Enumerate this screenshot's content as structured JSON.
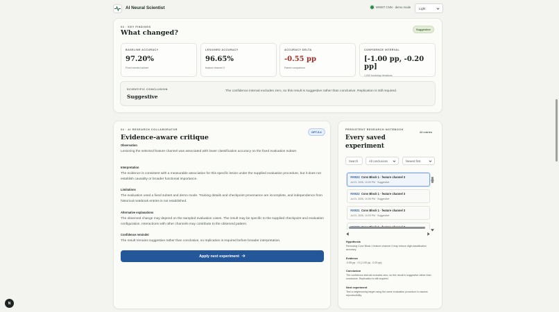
{
  "header": {
    "brand_name": "AI Neural Scientist",
    "status_text": "MNIST CNN · demo mode",
    "theme_value": "Light",
    "status_color": "#2f8a4b"
  },
  "findings": {
    "eyebrow": "03 · KEY FINDINGS",
    "title": "What changed?",
    "badge": "Suggestive",
    "metrics": [
      {
        "label": "BASELINE ACCURACY",
        "value": "97.20%",
        "sub": "Fixed seeded subset"
      },
      {
        "label": "LESIONED ACCURACY",
        "value": "96.65%",
        "sub": "feature channel 3"
      },
      {
        "label": "ACCURACY DELTA",
        "value": "-0.55 pp",
        "sub": "Paired comparison"
      },
      {
        "label": "CONFIDENCE INTERVAL",
        "value": "[-1.00 pp, -0.20 pp]",
        "sub": "1,000 bootstrap iterations"
      }
    ],
    "conclusion_label": "SCIENTIFIC CONCLUSION",
    "conclusion_word": "Suggestive",
    "conclusion_text": "The confidence interval excludes zero, so this result is suggestive rather than conclusive. Replication is still required."
  },
  "critique": {
    "eyebrow": "04 · AI RESEARCH COLLABORATOR",
    "title": "Evidence-aware critique",
    "badge": "GPT-5.4",
    "sections": [
      {
        "title": "Observation",
        "body": "Lesioning the selected feature channel was associated with lower classification accuracy on the fixed evaluation subset."
      },
      {
        "title": "Interpretation",
        "body": "The evidence is consistent with a measurable association for this specific lesion under the supplied evaluation procedure, but it does not establish causality or broader functional importance."
      },
      {
        "title": "Limitations",
        "body": "The evaluation used a fixed subset and demo mode. Training details and checkpoint provenance are incomplete, and independence from historical notebook entries is not established."
      },
      {
        "title": "Alternative explanations",
        "body": "The observed change may depend on the sampled evaluation cases. The result may be specific to the supplied checkpoint and evaluation configuration. Interactions with other channels may contribute to the observed pattern."
      },
      {
        "title": "Confidence reminder",
        "body": "The result remains suggestive rather than conclusive, so replication is required before broader interpretation."
      }
    ],
    "apply_button": "Apply next experiment",
    "accent": "#24569a"
  },
  "notebook": {
    "eyebrow": "PERSISTENT RESEARCH NOTEBOOK",
    "title_line1": "Every saved",
    "title_line2": "experiment",
    "count": "23 entries",
    "search_placeholder": "Search",
    "filter_value": "All conclusions",
    "sort_value": "Newest first",
    "entries": [
      {
        "id": "#00023",
        "name": "Conv Block 1 · feature channel 3",
        "meta": "Jul 21, 2026, 10:09 PM · Suggestive"
      },
      {
        "id": "#00022",
        "name": "Conv Block 1 · feature channel 3",
        "meta": "Jul 21, 2026, 10:06 PM · Suggestive"
      },
      {
        "id": "#00021",
        "name": "Conv Block 1 · feature channel 3",
        "meta": "Jul 21, 2026, 10:03 PM · Suggestive"
      },
      {
        "id": "#00020",
        "name": "Conv Block 1 · feature channel 3",
        "meta": ""
      }
    ],
    "detail": [
      {
        "title": "Hypothesis",
        "body": "Removing Conv Block 1 feature channel 3 may reduce digit classification accuracy."
      },
      {
        "title": "Evidence",
        "body": "-0.55 pp · CI [-1.00 pp, -0.20 pp]"
      },
      {
        "title": "Conclusion",
        "body": "The confidence interval excludes zero, so this result is suggestive rather than conclusive. Replication is still required."
      },
      {
        "title": "Next experiment",
        "body": "Test a neighbouring target using the same evaluation procedure to assess reproducibility."
      }
    ]
  },
  "fab_label": "N"
}
